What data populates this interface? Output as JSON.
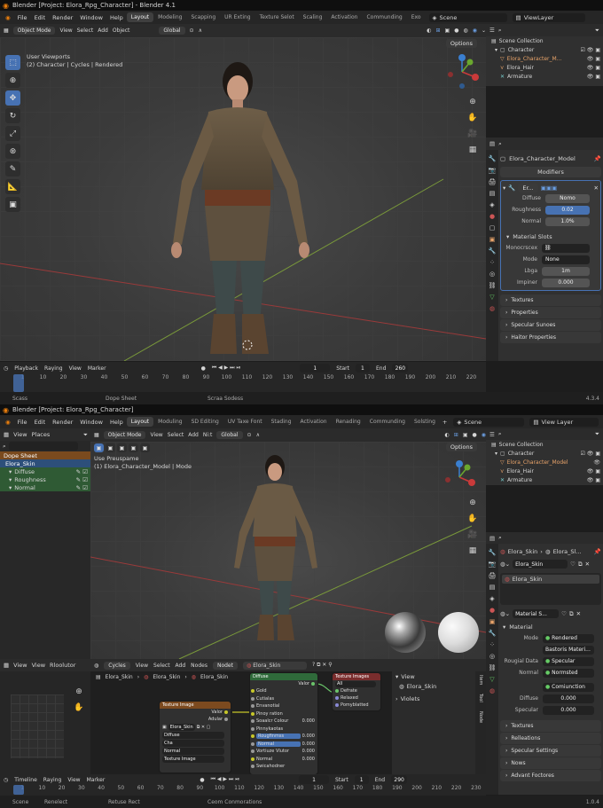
{
  "top": {
    "title": "Blender [Project: Elora_Rpg_Character] - Blender 4.1",
    "menu": [
      "File",
      "Edit",
      "Render",
      "Window",
      "Help"
    ],
    "workspaces": [
      "Layout",
      "Modeling",
      "Scapping",
      "UR Exting",
      "Texture Selot",
      "Scaling",
      "Activation",
      "Communding",
      "Exo"
    ],
    "scene": "Scene",
    "viewlayer": "ViewLayer",
    "header": {
      "mode": "Object Mode",
      "view": "View",
      "select": "Select",
      "add": "Add",
      "object": "Object",
      "orient": "Global",
      "options": "Options"
    },
    "viewport_line1": "User Viewports",
    "viewport_line2": "(2) Character | Cycles | Rendered",
    "outliner": {
      "root": "Scene Collection",
      "items": [
        {
          "label": "Character"
        },
        {
          "label": "Elora_Character_M..."
        },
        {
          "label": "Elora_Hair"
        },
        {
          "label": "Armature"
        }
      ]
    },
    "props": {
      "object": "Elora_Character_Model",
      "tab": "Modifiers",
      "modname": "Er...",
      "rows": [
        {
          "label": "Diffuse",
          "value": "Nomo"
        },
        {
          "label": "Roughness",
          "value": "0.02"
        },
        {
          "label": "Normal",
          "value": "1.0%"
        }
      ],
      "slots_title": "Material Slots",
      "slot_rows": [
        {
          "label": "Monocrscex",
          "value": ""
        },
        {
          "label": "Mode",
          "value": "None"
        },
        {
          "label": "Lbga",
          "value": "1m"
        },
        {
          "label": "Impiner",
          "value": "0.000"
        }
      ],
      "sections": [
        "Textures",
        "Properties",
        "Specular Sunoes",
        "Haitor Properties"
      ]
    },
    "timeline": {
      "playback": "Playback",
      "keying": "Raying",
      "view": "View",
      "marker": "Marker",
      "frame": "1",
      "start_label": "Start",
      "start": "1",
      "end_label": "End",
      "end": "260",
      "ticks": [
        "1",
        "10",
        "20",
        "30",
        "40",
        "50",
        "60",
        "70",
        "80",
        "90",
        "100",
        "110",
        "120",
        "130",
        "140",
        "150",
        "160",
        "170",
        "180",
        "190",
        "200",
        "210",
        "220"
      ]
    },
    "status": {
      "left": "Scass",
      "mid": "Dope Sheet",
      "right": "Scraa Sodess",
      "version": "4.3.4"
    }
  },
  "bottom": {
    "title": "Blender [Project: Elora_Rpg_Character]",
    "menu": [
      "File",
      "Edit",
      "Render",
      "Window",
      "Help"
    ],
    "workspaces": [
      "Layout",
      "Moduling",
      "SD Editing",
      "UV Taxe Font",
      "Stading",
      "Activation",
      "Renading",
      "Communding",
      "Solsting"
    ],
    "scene": "Scene",
    "viewlayer": "View Layer",
    "header": {
      "mode": "Object Mode",
      "view": "View",
      "select": "Select",
      "add": "Add",
      "ni": "Ni:t",
      "orient": "Global",
      "options": "Options",
      "left_view": "View",
      "left_places": "Places"
    },
    "viewport_line1": "Use Preuspame",
    "viewport_line2": "(1) Elora_Character_Model | Mode",
    "dopesheet": {
      "title": "Dope Sheet",
      "object": "Elora_Skin",
      "channels": [
        "Diffuse",
        "Roughness",
        "Normal"
      ]
    },
    "outliner": {
      "root": "Scene Collection",
      "items": [
        {
          "label": "Character"
        },
        {
          "label": "Elora_Character_Model"
        },
        {
          "label": "Elora_Hair"
        },
        {
          "label": "Armature"
        }
      ]
    },
    "props": {
      "crumb1": "Elora_Skin",
      "crumb2": "Elora_Sl...",
      "material": "Elora_Skin",
      "slot": "Elora_Skin",
      "mat_dd": "Material S...",
      "section": "Material",
      "rows": [
        {
          "label": "Mode",
          "value": "Rendered"
        },
        {
          "label": "",
          "value": "Bastoris Materi..."
        },
        {
          "label": "Rougial Data",
          "value": "Specular"
        },
        {
          "label": "Normal",
          "value": "Normsted"
        },
        {
          "label": "",
          "value": "Comiunction"
        },
        {
          "label": "Diffuse",
          "value": "0.000"
        },
        {
          "label": "Specular",
          "value": "0.000"
        }
      ],
      "sections": [
        "Textures",
        "Relleations",
        "Specular Settings",
        "Nows",
        "Advant Foctores"
      ]
    },
    "nodes": {
      "header": {
        "view": "View",
        "view2": "View",
        "rlooluter": "Rloolutor",
        "engine": "Cycles",
        "view3": "View",
        "select": "Select",
        "add": "Add",
        "nodes": "Nodes",
        "nodet": "Nodet",
        "mat": "Elora_Skin"
      },
      "crumbs": [
        "Elora_Skin",
        "Elora_Skin",
        "Elora_Skin"
      ],
      "principled": {
        "title": "Diffuse",
        "out": "Valor",
        "rows": [
          "Gold",
          "Cutialas",
          "Envanotial",
          "Pinoy ration",
          "Soaalcr Colour",
          "Pinnykaotas",
          "Rougfinmss",
          "Normal",
          "Vortiuze Vlutor",
          "Normal",
          "Swicahodner"
        ],
        "vals": [
          "",
          "",
          "",
          "",
          "0.000",
          "",
          "0.000",
          "0.000",
          "0.000",
          "0.000",
          ""
        ]
      },
      "texture": {
        "title": "Texture Image",
        "rows": [
          "Valor",
          "Adular"
        ],
        "img": "Elora_Skin",
        "opts": [
          "Diffuse",
          "Cha",
          "Normal",
          "Texture Image"
        ]
      },
      "imgtex": {
        "title": "Texture Images",
        "opt": "All",
        "rows": [
          "Defrate",
          "Relaxed",
          "Pomyblatted"
        ]
      },
      "side": {
        "view": "View",
        "item": "Elora_Skin",
        "views": "Violets",
        "tabs": [
          "Item",
          "Tool",
          "Node"
        ]
      }
    },
    "timeline": {
      "timeline": "Timeline",
      "keying": "Raying",
      "view": "View",
      "marker": "Marker",
      "frame": "1",
      "start_label": "Start",
      "start": "1",
      "end_label": "End",
      "end": "290",
      "ticks": [
        "1",
        "10",
        "20",
        "30",
        "40",
        "50",
        "60",
        "70",
        "80",
        "90",
        "100",
        "110",
        "120",
        "130",
        "140",
        "150",
        "160",
        "170",
        "180",
        "190",
        "200",
        "210",
        "220",
        "230"
      ]
    },
    "status": {
      "left": "Scene",
      "mid": "Renelect",
      "mid2": "Retuse Rect",
      "right": "Ceom Conmorations",
      "version": "1.0.4"
    }
  },
  "colors": {
    "accent": "#4772b3",
    "header": "#2b2b2b",
    "panel": "#303030",
    "node_green": "#2f6a3a",
    "node_red": "#7a2d2d",
    "node_tex": "#7c4a1f"
  }
}
